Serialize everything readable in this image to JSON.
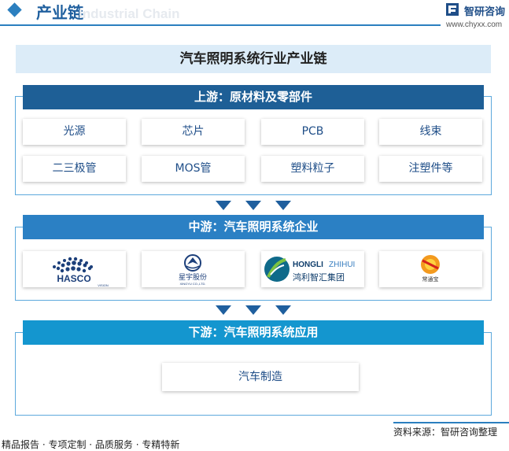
{
  "header": {
    "title": "产业链",
    "watermark": "Industrial Chain",
    "brand_name": "智研咨询",
    "brand_url": "www.chyxx.com"
  },
  "diagram": {
    "title": "汽车照明系统行业产业链",
    "upstream": {
      "heading": "上游：原材料及零部件",
      "items": [
        "光源",
        "芯片",
        "PCB",
        "线束",
        "二三极管",
        "MOS管",
        "塑料粒子",
        "注塑件等"
      ]
    },
    "midstream": {
      "heading": "中游：汽车照明系统企业",
      "logos": [
        {
          "text": "HASCO",
          "sub": "VISION"
        },
        {
          "text": "星宇股份",
          "sub": "XINGYU CO.,LTD."
        },
        {
          "text": "HONGLI",
          "text2": "ZHIHUI",
          "sub": "鸿利智汇集团"
        },
        {
          "text": "常通宝"
        }
      ]
    },
    "downstream": {
      "heading": "下游：汽车照明系统应用",
      "items": [
        "汽车制造"
      ]
    }
  },
  "footer": {
    "source": "资料来源：智研咨询整理",
    "tagline": "精品报告 · 专项定制 · 品质服务 · 专精特新"
  },
  "colors": {
    "upstream_head": "#1e5f96",
    "midstream_head": "#2b80c4",
    "downstream_head": "#1496cf",
    "arrow": "#1f5f9e",
    "text_blue": "#1f4e88"
  }
}
